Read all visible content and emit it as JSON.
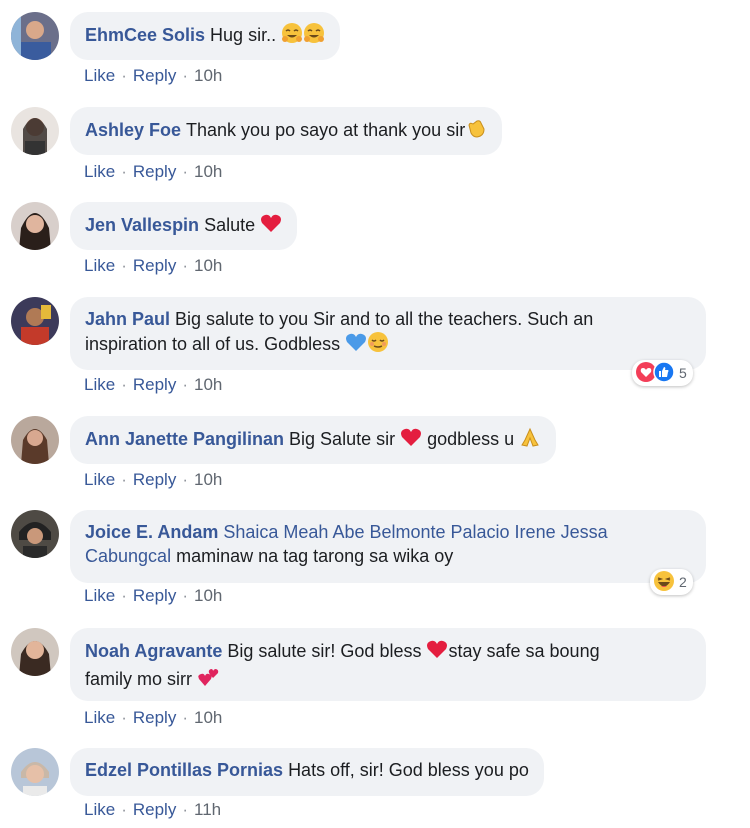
{
  "comments": [
    {
      "name": "EhmCee Solis",
      "text": "Hug sir..",
      "time": "10h"
    },
    {
      "name": "Ashley Foe",
      "text": "Thank you po sayo at thank you sir",
      "time": "10h"
    },
    {
      "name": "Jen Vallespin",
      "text": "Salute",
      "time": "10h"
    },
    {
      "name": "Jahn Paul",
      "line1": "Big salute to you Sir and to all the teachers. Such an",
      "line2": "inspiration to all of us. Godbless",
      "time": "10h",
      "reaction_count": "5"
    },
    {
      "name": "Ann Janette Pangilinan",
      "text": "Big Salute sir",
      "text2": "godbless u",
      "time": "10h"
    },
    {
      "name": "Joice E. Andam",
      "tags": "Shaica Meah Abe Belmonte Palacio Irene Jessa",
      "tags2": "Cabungcal",
      "text": "maminaw na tag tarong sa wika oy",
      "time": "10h",
      "reaction_count": "2"
    },
    {
      "name": "Noah Agravante",
      "line1": "Big salute sir! God bless",
      "line1b": "stay safe sa boung",
      "line2": "family mo sirr",
      "time": "10h"
    },
    {
      "name": "Edzel Pontillas Pornias",
      "text": "Hats off, sir! God bless you po",
      "time": "11h"
    }
  ],
  "actions": {
    "like": "Like",
    "reply": "Reply",
    "dot": "·"
  },
  "colors": {
    "name": "#385898",
    "bubble": "#f0f2f5",
    "action": "#385898",
    "time": "#606770",
    "heart": "#e41e3f",
    "like_blue": "#1877f2"
  }
}
